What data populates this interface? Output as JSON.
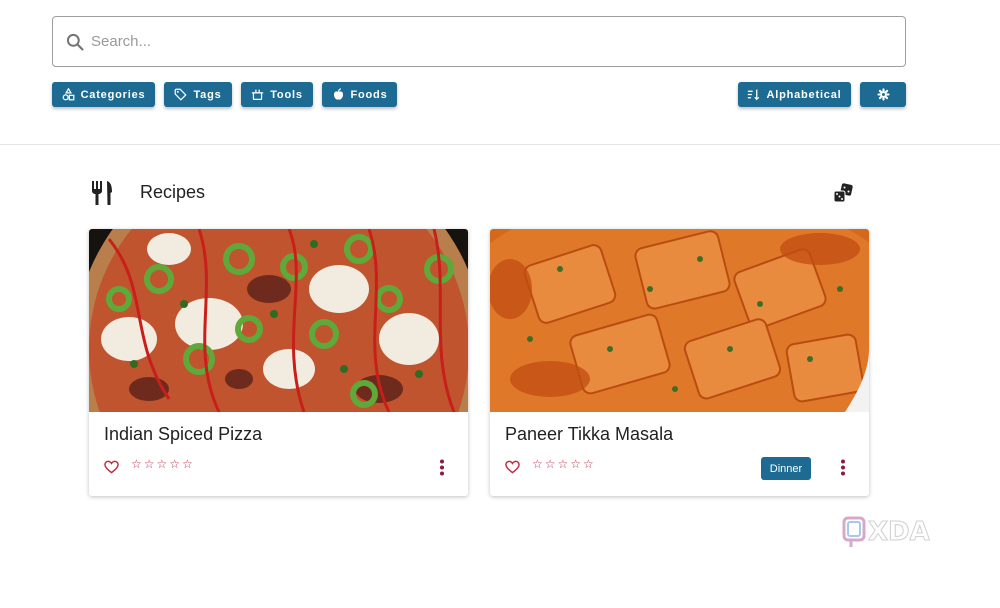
{
  "search": {
    "placeholder": "Search..."
  },
  "filters": {
    "categories_label": "Categories",
    "tags_label": "Tags",
    "tools_label": "Tools",
    "foods_label": "Foods",
    "sort_label": "Alphabetical",
    "settings_icon": "gear-icon"
  },
  "section": {
    "title": "Recipes",
    "icon": "fork-knife-icon",
    "random_icon": "dice-icon"
  },
  "recipes": [
    {
      "title": "Indian Spiced Pizza",
      "stars": "☆☆☆☆☆",
      "tag": ""
    },
    {
      "title": "Paneer Tikka Masala",
      "stars": "☆☆☆☆☆",
      "tag": "Dinner"
    }
  ],
  "colors": {
    "accent": "#1d6b93",
    "rating": "#c0304a"
  },
  "watermark": {
    "text": "XDA"
  }
}
